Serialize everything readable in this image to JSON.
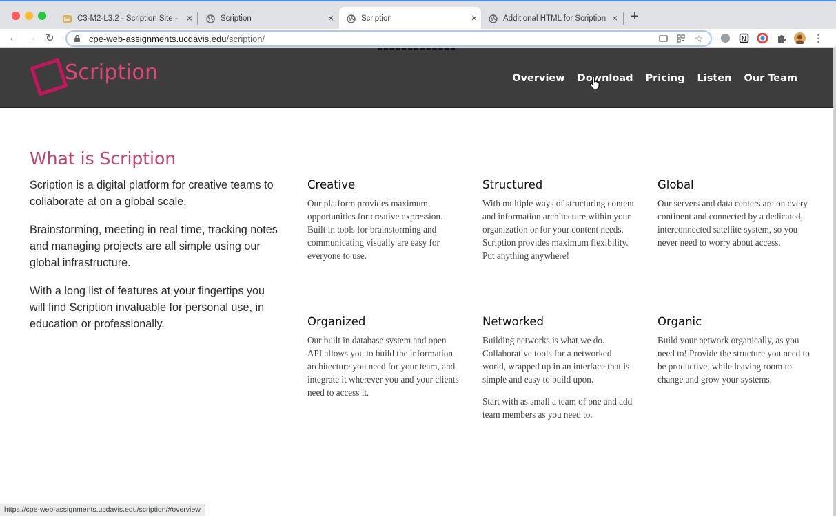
{
  "browser": {
    "tabs": [
      {
        "title": "C3-M2-L3.2 - Scription Site - ",
        "icon": "docs-icon"
      },
      {
        "title": "Scription",
        "icon": "globe-icon"
      },
      {
        "title": "Scription",
        "icon": "globe-icon",
        "active": true
      },
      {
        "title": "Additional HTML for Scription",
        "icon": "globe-icon"
      }
    ],
    "url_host": "cpe-web-assignments.ucdavis.edu",
    "url_path": "/scription/",
    "status_url": "https://cpe-web-assignments.ucdavis.edu/scription/#overview"
  },
  "site": {
    "logo_text": "Scription",
    "nav": [
      "Overview",
      "Download",
      "Pricing",
      "Listen",
      "Our Team"
    ]
  },
  "intro": {
    "title": "What is Scription",
    "paragraphs": [
      "Scription is a digital platform for creative teams to collaborate at on a global scale.",
      "Brainstorming, meeting in real time, tracking notes and managing projects are all simple using our global infrastructure.",
      "With a long list of features at your fingertips you will find Scription invaluable for personal use, in education or professionally."
    ]
  },
  "features": [
    {
      "title": "Creative",
      "paragraphs": [
        "Our platform provides maximum opportunities for creative expression. Built in tools for brainstorming and communicating visually are easy for everyone to use."
      ]
    },
    {
      "title": "Structured",
      "paragraphs": [
        "With multiple ways of structuring content and information architecture within your organization or for your content needs, Scription provides maximum flexibility. Put anything anywhere!"
      ]
    },
    {
      "title": "Global",
      "paragraphs": [
        "Our servers and data centers are on every continent and connected by a dedicated, interconnected satellite system, so you never need to worry about access."
      ]
    },
    {
      "title": "Organized",
      "paragraphs": [
        "Our built in database system and open API allows you to build the information architecture you need for your team, and integrate it wherever you and your clients need to access it."
      ]
    },
    {
      "title": "Networked",
      "paragraphs": [
        "Building networks is what we do. Collaborative tools for a networked world, wrapped up in an interface that is simple and easy to build upon.",
        "Start with as small a team of one and add team members as you need to."
      ]
    },
    {
      "title": "Organic",
      "paragraphs": [
        "Build your network organically, as you need to! Provide the structure you need to be productive, while leaving room to change and grow your systems."
      ]
    }
  ],
  "colors": {
    "brand_pink": "#c2416b",
    "header_bg": "#3d3d3d"
  }
}
